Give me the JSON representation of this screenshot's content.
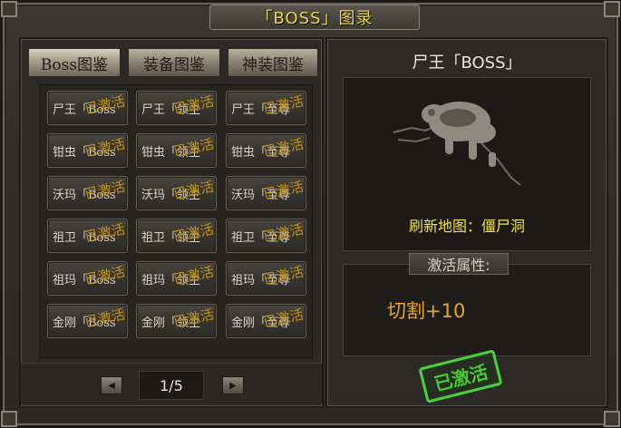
{
  "window": {
    "title": "「BOSS」图录"
  },
  "tabs": [
    {
      "label": "Boss图鉴",
      "active": true
    },
    {
      "label": "装备图鉴",
      "active": false
    },
    {
      "label": "神装图鉴",
      "active": false
    }
  ],
  "grid": {
    "rows": [
      [
        {
          "name": "尸王「Boss",
          "stamp": "已激活"
        },
        {
          "name": "尸王「领主",
          "stamp": "已激活"
        },
        {
          "name": "尸王「至尊",
          "stamp": "已激活"
        }
      ],
      [
        {
          "name": "钳虫「Boss",
          "stamp": "已激活"
        },
        {
          "name": "钳虫「领主",
          "stamp": "已激活"
        },
        {
          "name": "钳虫「至尊",
          "stamp": "已激活"
        }
      ],
      [
        {
          "name": "沃玛「Boss",
          "stamp": "已激活"
        },
        {
          "name": "沃玛「领主",
          "stamp": "已激活"
        },
        {
          "name": "沃玛「至尊",
          "stamp": "已激活"
        }
      ],
      [
        {
          "name": "祖卫「Boss",
          "stamp": "已激活"
        },
        {
          "name": "祖卫「领主",
          "stamp": "已激活"
        },
        {
          "name": "祖卫「至尊",
          "stamp": "已激活"
        }
      ],
      [
        {
          "name": "祖玛「Boss",
          "stamp": "已激活"
        },
        {
          "name": "祖玛「领主",
          "stamp": "已激活"
        },
        {
          "name": "祖玛「至尊",
          "stamp": "已激活"
        }
      ],
      [
        {
          "name": "金刚「Boss",
          "stamp": "已激活"
        },
        {
          "name": "金刚「领主",
          "stamp": "已激活"
        },
        {
          "name": "金刚「至尊",
          "stamp": "已激活"
        }
      ]
    ]
  },
  "pager": {
    "prev_icon": "left-arrow-icon",
    "next_icon": "right-arrow-icon",
    "page": "1/5"
  },
  "detail": {
    "boss_name": "尸王「BOSS」",
    "refresh_map": "刷新地图：僵尸洞",
    "attr_header": "激活属性:",
    "attr_value": "切割+10",
    "activated_label": "已激活"
  },
  "colors": {
    "title_gold": "#f2d64b",
    "map_yellow": "#f1e243",
    "attr_orange": "#e8a52a",
    "stamp_green": "#47c938",
    "stamp_gold": "#d8a21c"
  }
}
